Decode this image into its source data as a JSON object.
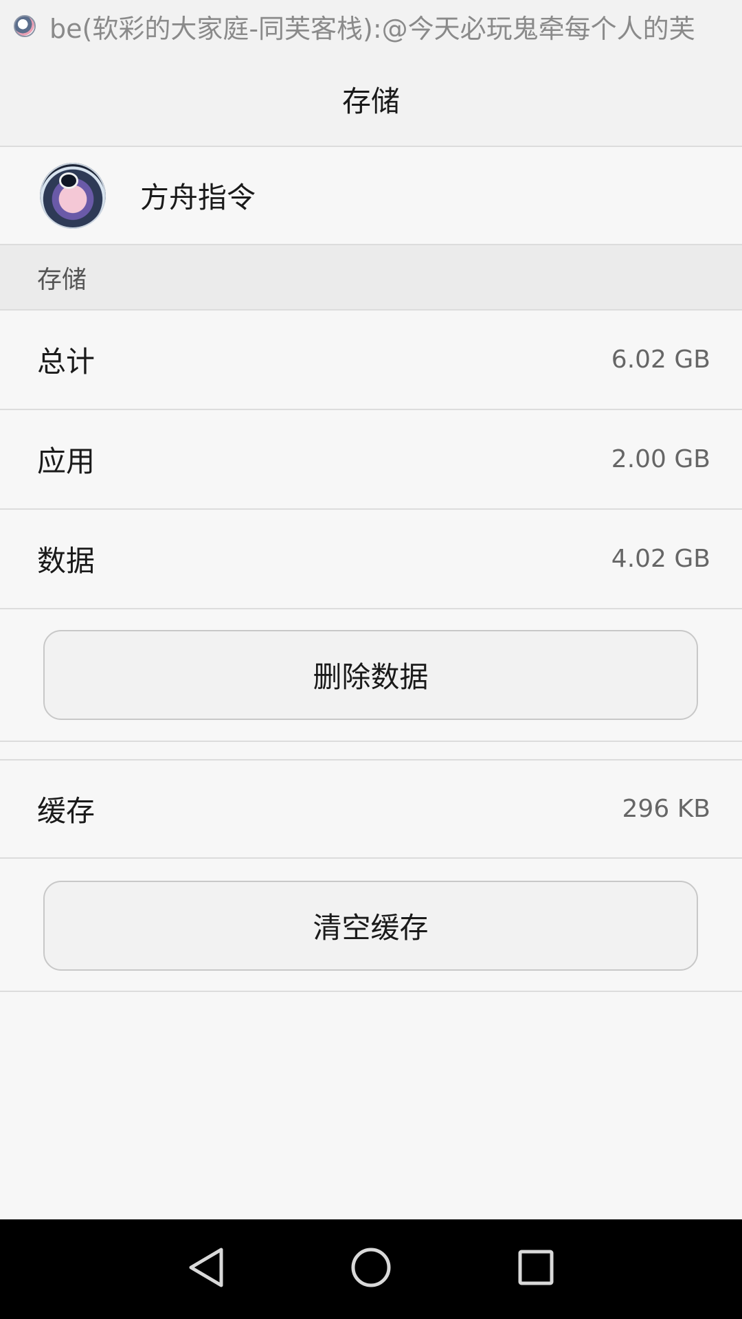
{
  "notification": {
    "text": "be(软彩的大家庭-同芙客栈):@今天必玩鬼牵每个人的芙"
  },
  "header": {
    "title": "存储"
  },
  "app": {
    "name": "方舟指令"
  },
  "storage": {
    "section_label": "存储",
    "total_label": "总计",
    "total_value": "6.02 GB",
    "app_label": "应用",
    "app_value": "2.00 GB",
    "data_label": "数据",
    "data_value": "4.02 GB",
    "delete_button": "删除数据"
  },
  "cache": {
    "label": "缓存",
    "value": "296 KB",
    "clear_button": "清空缓存"
  },
  "navbar": {
    "icons": [
      "back-icon",
      "home-icon",
      "recents-icon"
    ]
  }
}
